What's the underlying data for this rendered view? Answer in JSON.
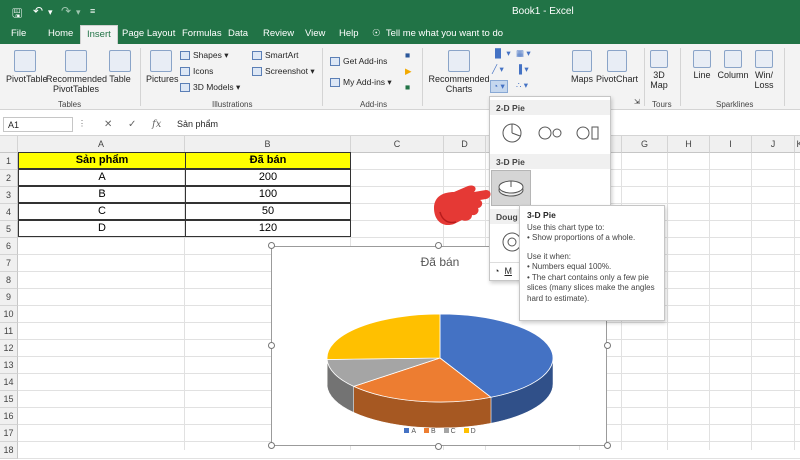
{
  "app": {
    "title": "Book1  -  Excel"
  },
  "tabs": [
    {
      "label": "File"
    },
    {
      "label": "Home"
    },
    {
      "label": "Insert"
    },
    {
      "label": "Page Layout"
    },
    {
      "label": "Formulas"
    },
    {
      "label": "Data"
    },
    {
      "label": "Review"
    },
    {
      "label": "View"
    },
    {
      "label": "Help"
    }
  ],
  "tellme": "Tell me what you want to do",
  "ribbon": {
    "tables": {
      "pivottable": "PivotTable",
      "recommended": "Recommended PivotTables",
      "table": "Table",
      "group": "Tables"
    },
    "illustrations": {
      "pictures": "Pictures",
      "shapes": "Shapes",
      "icons": "Icons",
      "models": "3D Models",
      "smartart": "SmartArt",
      "screenshot": "Screenshot",
      "group": "Illustrations"
    },
    "addins": {
      "get": "Get Add-ins",
      "my": "My Add-ins",
      "group": "Add-ins"
    },
    "charts": {
      "recommended": "Recommended Charts",
      "maps": "Maps",
      "pivotchart": "PivotChart"
    },
    "tours": {
      "map3d": "3D Map",
      "group": "Tours"
    },
    "sparklines": {
      "line": "Line",
      "column": "Column",
      "winloss": "Win/ Loss",
      "group": "Sparklines"
    }
  },
  "formula_bar": {
    "namebox": "A1",
    "fx": "fx",
    "value": "Sản phẩm"
  },
  "columns": [
    "A",
    "B",
    "C",
    "D",
    "E",
    "F",
    "G",
    "H",
    "I",
    "J",
    "K"
  ],
  "rows": [
    "1",
    "2",
    "3",
    "4",
    "5",
    "6",
    "7",
    "8",
    "9",
    "10",
    "11",
    "12",
    "13",
    "14",
    "15",
    "16",
    "17",
    "18"
  ],
  "table": {
    "headers": [
      "Sản phẩm",
      "Đã bán"
    ],
    "rows": [
      [
        "A",
        "200"
      ],
      [
        "B",
        "100"
      ],
      [
        "C",
        "50"
      ],
      [
        "D",
        "120"
      ]
    ]
  },
  "dropdown": {
    "pie2d": "2-D Pie",
    "pie3d": "3-D Pie",
    "doughnut": "Doug",
    "more": "M"
  },
  "tooltip": {
    "title": "3-D Pie",
    "line1": "Use this chart type to:",
    "line2": "• Show proportions of a whole.",
    "line3": "Use it when:",
    "line4": "• Numbers equal 100%.",
    "line5": "• The chart contains only a few pie slices (many slices make the angles hard to estimate)."
  },
  "colors": {
    "excel_green": "#217346",
    "highlight": "#ffff00",
    "pointer_hand": "#e53935"
  },
  "chart_data": {
    "type": "pie",
    "title": "Đã bán",
    "categories": [
      "A",
      "B",
      "C",
      "D"
    ],
    "values": [
      200,
      100,
      50,
      120
    ],
    "colors": [
      "#4472c4",
      "#ed7d31",
      "#a5a5a5",
      "#ffc000"
    ],
    "legend": "bottom"
  }
}
